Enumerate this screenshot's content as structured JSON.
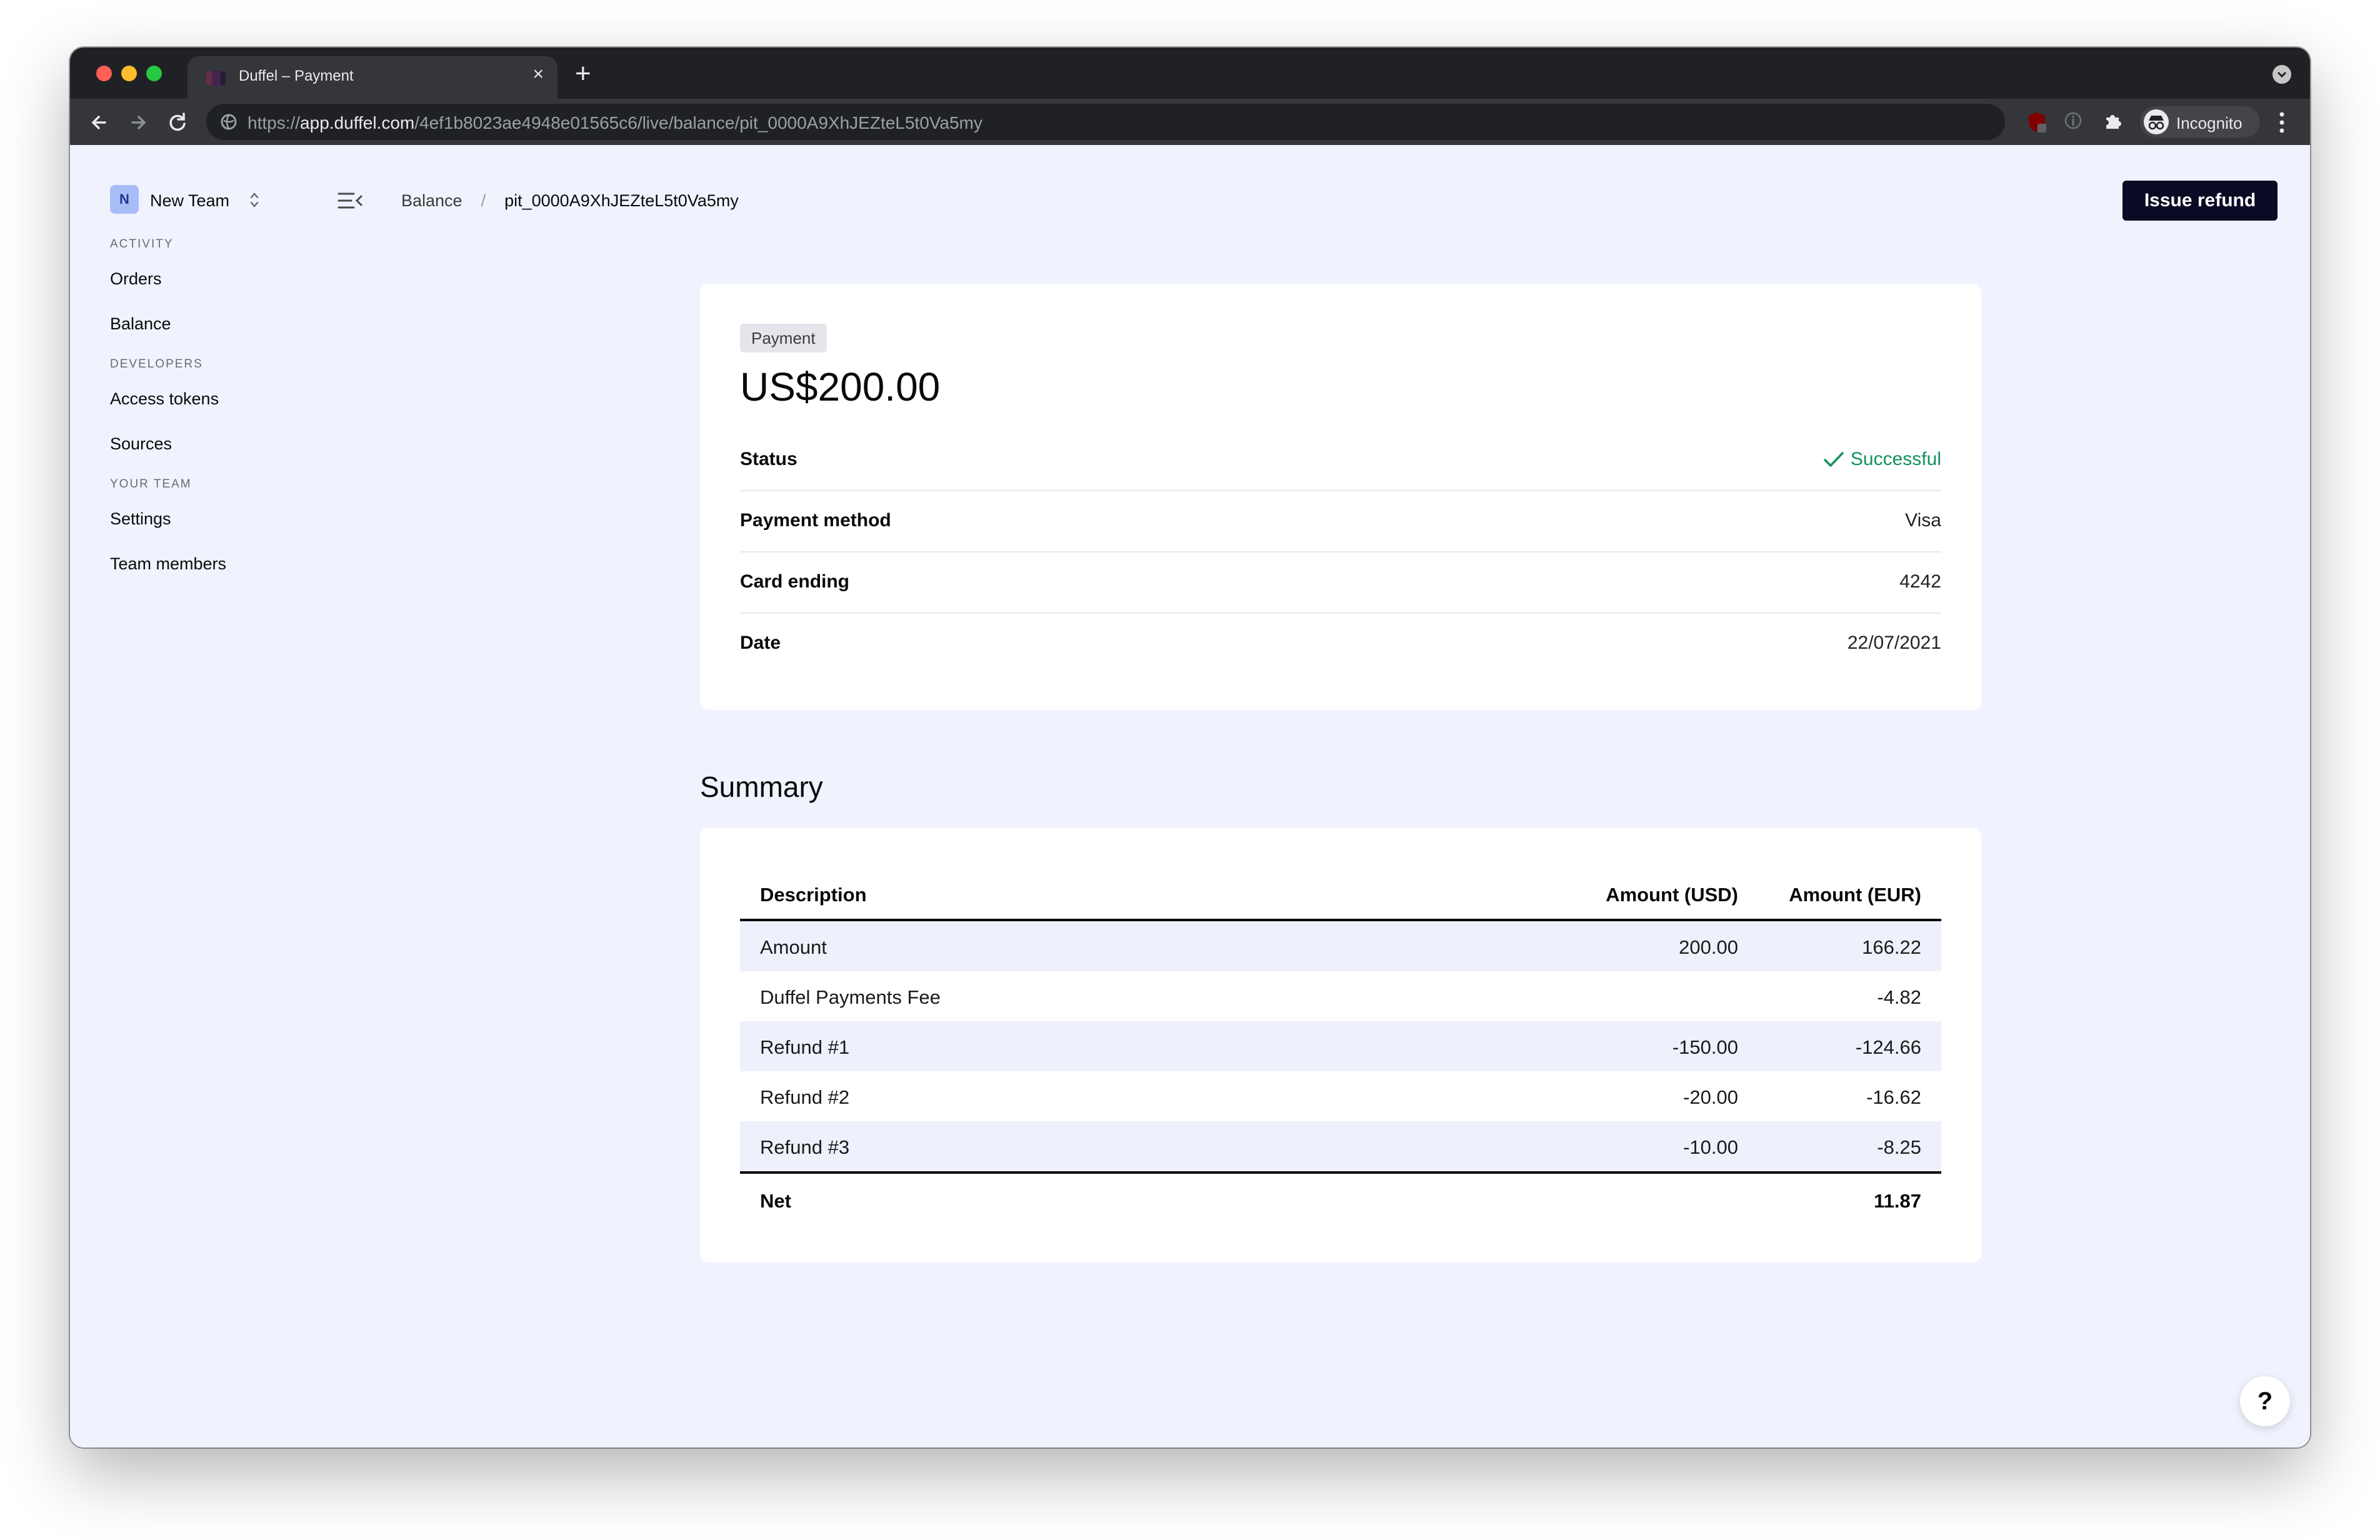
{
  "browser": {
    "tab_title": "Duffel – Payment",
    "tab_close": "×",
    "new_tab": "+",
    "url_scheme": "https://",
    "url_host": "app.duffel.com",
    "url_path": "/4ef1b8023ae4948e01565c6/live/balance/pit_0000A9XhJEZteL5t0Va5my",
    "profile_label": "Incognito",
    "colors": {
      "titlebar": "#202124",
      "toolbar": "#35363a",
      "close": "#ff5f57",
      "minimize": "#febc2e",
      "zoom": "#28c840"
    }
  },
  "team": {
    "avatar_letter": "N",
    "name": "New Team"
  },
  "breadcrumb": {
    "parent": "Balance",
    "separator": "/",
    "current": "pit_0000A9XhJEZteL5t0Va5my"
  },
  "actions": {
    "issue_refund": "Issue refund",
    "help": "?"
  },
  "sidebar": {
    "sections": [
      {
        "title": "ACTIVITY",
        "items": [
          "Orders",
          "Balance"
        ]
      },
      {
        "title": "DEVELOPERS",
        "items": [
          "Access tokens",
          "Sources"
        ]
      },
      {
        "title": "YOUR TEAM",
        "items": [
          "Settings",
          "Team members"
        ]
      }
    ]
  },
  "payment": {
    "badge": "Payment",
    "amount": "US$200.00",
    "details": [
      {
        "label": "Status",
        "value": "Successful"
      },
      {
        "label": "Payment method",
        "value": "Visa"
      },
      {
        "label": "Card ending",
        "value": "4242"
      },
      {
        "label": "Date",
        "value": "22/07/2021"
      }
    ],
    "status_color": "#12935b"
  },
  "summary": {
    "title": "Summary",
    "columns": [
      "Description",
      "Amount (USD)",
      "Amount (EUR)"
    ],
    "rows": [
      {
        "description": "Amount",
        "usd": "200.00",
        "eur": "166.22"
      },
      {
        "description": "Duffel Payments Fee",
        "usd": "",
        "eur": "-4.82"
      },
      {
        "description": "Refund #1",
        "usd": "-150.00",
        "eur": "-124.66"
      },
      {
        "description": "Refund #2",
        "usd": "-20.00",
        "eur": "-16.62"
      },
      {
        "description": "Refund #3",
        "usd": "-10.00",
        "eur": "-8.25"
      }
    ],
    "net": {
      "label": "Net",
      "usd": "",
      "eur": "11.87"
    }
  }
}
